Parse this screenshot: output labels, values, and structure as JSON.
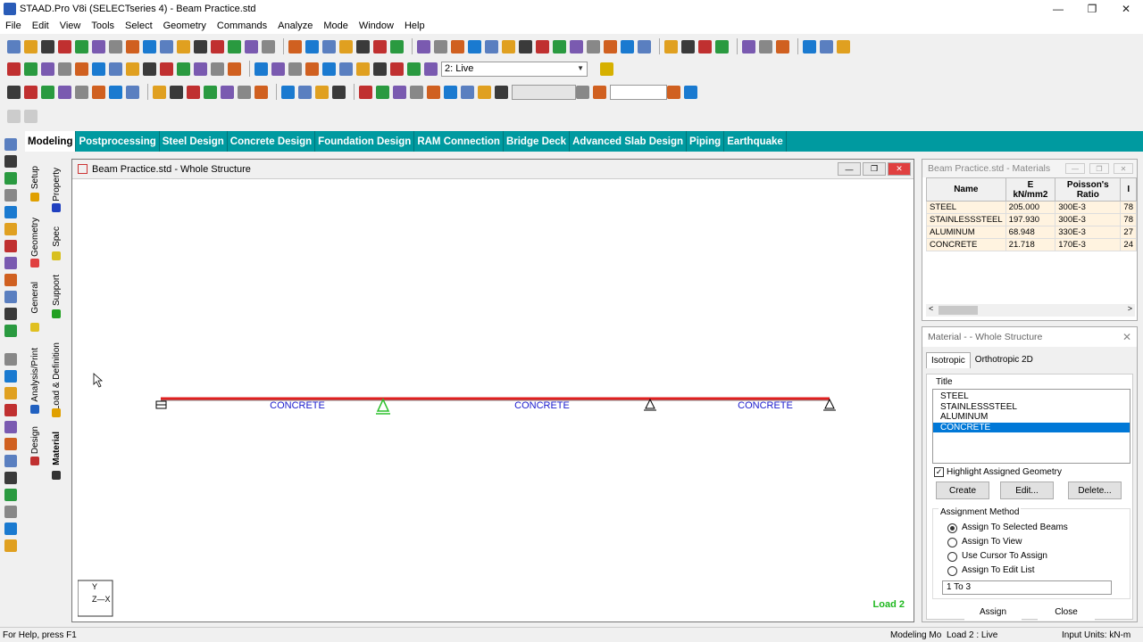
{
  "window": {
    "title": "STAAD.Pro V8i (SELECTseries 4) - Beam Practice.std",
    "controls": [
      "—",
      "❐",
      "✕"
    ]
  },
  "menu": [
    "File",
    "Edit",
    "View",
    "Tools",
    "Select",
    "Geometry",
    "Commands",
    "Analyze",
    "Mode",
    "Window",
    "Help"
  ],
  "toolbar": {
    "load_combo": "2: Live",
    "help_icon": "help-icon"
  },
  "page_tabs": [
    {
      "label": "Modeling",
      "active": true
    },
    {
      "label": "Postprocessing"
    },
    {
      "label": "Steel Design"
    },
    {
      "label": "Concrete Design"
    },
    {
      "label": "Foundation Design"
    },
    {
      "label": "RAM Connection"
    },
    {
      "label": "Bridge Deck"
    },
    {
      "label": "Advanced Slab Design"
    },
    {
      "label": "Piping"
    },
    {
      "label": "Earthquake"
    }
  ],
  "side_tabs": {
    "setup": "Setup",
    "geometry": "Geometry",
    "general": "General",
    "analysis": "Analysis/Print",
    "design": "Design",
    "property": "Property",
    "spec": "Spec",
    "support": "Support",
    "load": "Load & Definition",
    "material": "Material"
  },
  "structure_window": {
    "title": "Beam Practice.std - Whole Structure",
    "beam_labels": [
      "CONCRETE",
      "CONCRETE",
      "CONCRETE"
    ],
    "axis_labels": {
      "y": "Y",
      "zx": "Z—X"
    },
    "load_label": "Load 2",
    "beam_color": "#e02020",
    "label_color": "#1a1acc",
    "load_color": "#1fb81f"
  },
  "materials_table": {
    "title": "Beam Practice.std - Materials",
    "headers": [
      "Name",
      "E\nkN/mm2",
      "Poisson's Ratio",
      "I"
    ],
    "rows": [
      [
        "STEEL",
        "205.000",
        "300E-3",
        "78"
      ],
      [
        "STAINLESSSTEEL",
        "197.930",
        "300E-3",
        "78"
      ],
      [
        "ALUMINUM",
        "68.948",
        "330E-3",
        "27"
      ],
      [
        "CONCRETE",
        "21.718",
        "170E-3",
        "24"
      ]
    ]
  },
  "material_dialog": {
    "title": "Material -  - Whole Structure",
    "tabs": [
      "Isotropic",
      "Orthotropic 2D"
    ],
    "list_label": "Title",
    "list": [
      "STEEL",
      "STAINLESSSTEEL",
      "ALUMINUM",
      "CONCRETE"
    ],
    "selected": "CONCRETE",
    "highlight_label": "Highlight Assigned Geometry",
    "buttons": {
      "create": "Create",
      "edit": "Edit...",
      "delete": "Delete...",
      "assign": "Assign",
      "close": "Close"
    },
    "assignment_label": "Assignment Method",
    "methods": [
      "Assign To Selected Beams",
      "Assign To View",
      "Use Cursor To Assign",
      "Assign To Edit List"
    ],
    "edit_list": "1 To 3"
  },
  "status": {
    "left": "For Help, press F1",
    "mode": "Modeling Mo",
    "load": "Load 2 : Live",
    "units": "Input Units:  kN-m"
  }
}
